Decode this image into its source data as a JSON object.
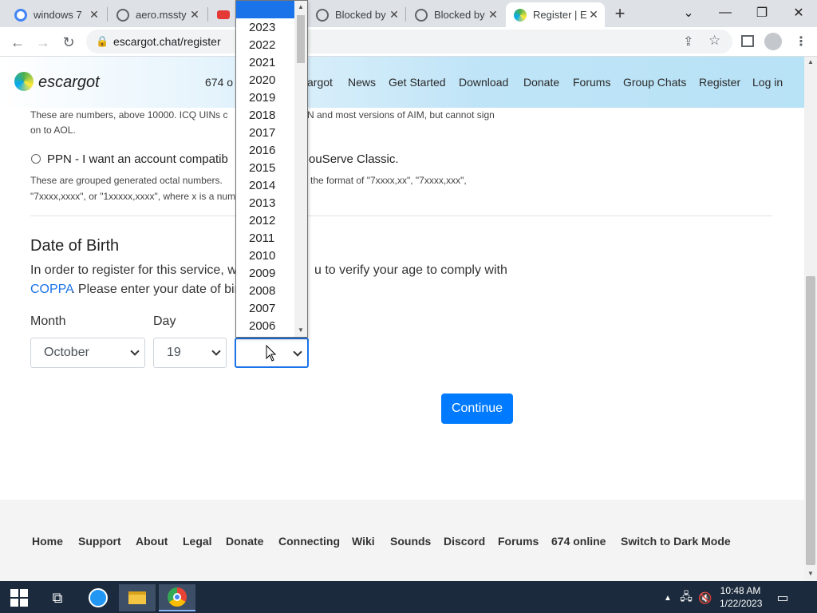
{
  "browser": {
    "tabs": [
      {
        "title": "windows 7",
        "favicon_color": "#4285f4"
      },
      {
        "title": "aero.mssty",
        "favicon_color": "#5f6368"
      },
      {
        "title": "",
        "favicon_color": "#e53935"
      },
      {
        "title": "Blocked by",
        "favicon_color": "#5f6368"
      },
      {
        "title": "Blocked by",
        "favicon_color": "#5f6368"
      },
      {
        "title": "Register | E",
        "favicon_color": "#8bc34a",
        "active": true
      }
    ],
    "new_tab_label": "+",
    "url": "escargot.chat/register"
  },
  "site": {
    "logo_text": "escargot",
    "online_count_partial": "674 o",
    "nav_partial": "argot",
    "nav": [
      "News",
      "Get Started",
      "Download",
      "Donate",
      "Forums",
      "Group Chats",
      "Register",
      "Log in"
    ]
  },
  "content": {
    "icq_desc_line1": "These are numbers, above 10000. ICQ UINs c",
    "icq_desc_line1b": "N and most versions of AIM, but cannot sign",
    "icq_desc_line2": "on to AOL.",
    "ppn_label_a": "PPN - I want an account compatib",
    "ppn_label_b": "ouServe Classic.",
    "ppn_desc_line1a": "These are grouped generated octal numbers.",
    "ppn_desc_line1b": "the format of \"7xxxx,xx\", \"7xxxx,xxx\",",
    "ppn_desc_line2": "\"7xxxx,xxxx\", or \"1xxxxx,xxxx\", where x is a num",
    "dob_heading": "Date of Birth",
    "dob_text_a": "In order to register for this service, w",
    "dob_text_b": "u to verify your age to comply with",
    "coppa_link": "COPPA",
    "dob_text_c": ". Please enter your date of bir",
    "month_label": "Month",
    "day_label": "Day",
    "month_value": "October",
    "day_value": "19",
    "year_value": "",
    "continue_label": "Continue"
  },
  "year_dropdown": {
    "options": [
      "2023",
      "2022",
      "2021",
      "2020",
      "2019",
      "2018",
      "2017",
      "2016",
      "2015",
      "2014",
      "2013",
      "2012",
      "2011",
      "2010",
      "2009",
      "2008",
      "2007",
      "2006"
    ]
  },
  "footer": {
    "links": [
      "Home",
      "Support",
      "About",
      "Legal",
      "Donate",
      "Connecting",
      "Wiki",
      "Sounds",
      "Discord",
      "Forums",
      "674 online",
      "Switch to Dark Mode"
    ]
  },
  "taskbar": {
    "time": "10:48 AM",
    "date": "1/22/2023"
  },
  "colors": {
    "accent": "#007bff",
    "link": "#1a73e8",
    "taskbar": "#1b2a3c"
  }
}
